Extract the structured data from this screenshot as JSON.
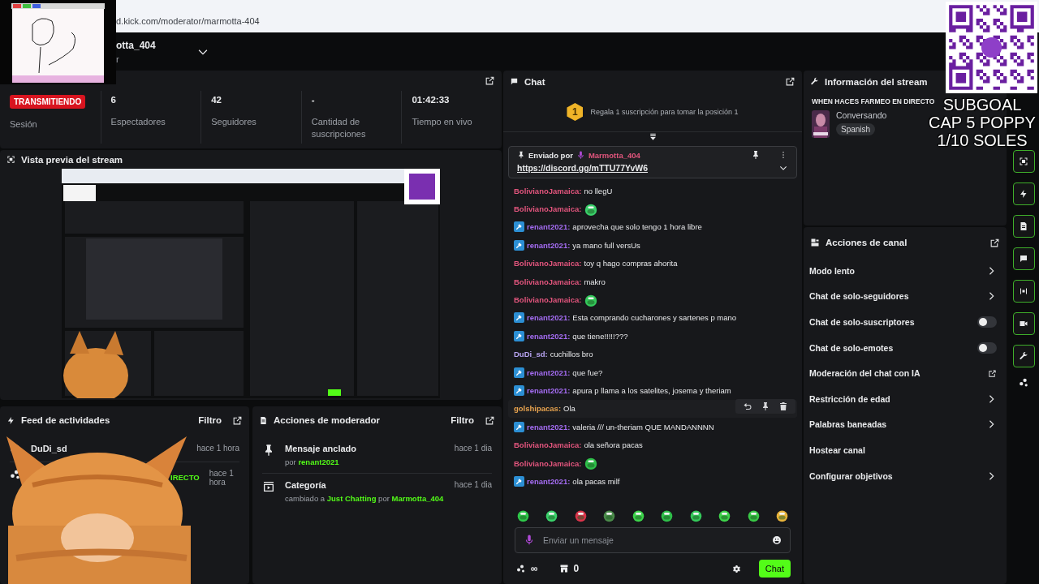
{
  "browser": {
    "url": "d.kick.com/moderator/marmotta-404"
  },
  "header": {
    "channel": "otta_404",
    "role": "r"
  },
  "stats": [
    {
      "kind": "badge",
      "value": "TRANSMITIENDO",
      "label": "Sesión"
    },
    {
      "kind": "number",
      "value": "6",
      "label": "Espectadores"
    },
    {
      "kind": "number",
      "value": "42",
      "label": "Seguidores"
    },
    {
      "kind": "number",
      "value": "-",
      "label": "Cantidad de suscripciones"
    },
    {
      "kind": "number",
      "value": "01:42:33",
      "label": "Tiempo en vivo"
    }
  ],
  "preview": {
    "title": "Vista previa del stream",
    "kind": "picture"
  },
  "activity_feed": {
    "title": "Feed de actividades",
    "filter": "Filtro",
    "items": [
      {
        "name": "DuDi_sd",
        "time": "hace 1 hora"
      },
      {
        "time": "hace 1 hora",
        "detail": "IRECTO"
      }
    ]
  },
  "mod_actions": {
    "title": "Acciones de moderador",
    "filter": "Filtro",
    "items": [
      {
        "kind": "pin",
        "title": "Mensaje anclado",
        "detail": [
          {
            "text": "por "
          },
          {
            "text": "renant2021",
            "highlight": true
          }
        ],
        "time": "hace 1 dia"
      },
      {
        "kind": "category",
        "title": "Categoría",
        "detail": [
          {
            "text": "cambiado a "
          },
          {
            "text": "Just Chatting",
            "highlight": true
          },
          {
            "text": " por "
          },
          {
            "text": "Marmotta_404",
            "highlight": true
          }
        ],
        "time": "hace 1 dia"
      }
    ]
  },
  "chat": {
    "title": "Chat",
    "goal": {
      "rank": "1",
      "text": "Regala 1 suscripción para tomar la posición 1"
    },
    "pinned": {
      "label": "Enviado por",
      "user": "Marmotta_404",
      "link": "https://discord.gg/mTTU77YvW6"
    },
    "messages": [
      {
        "user": "BolivianoJamaica:",
        "color": "#e2557d",
        "moderator": false,
        "kind": "text",
        "text": "no llegU",
        "highlighted": false
      },
      {
        "user": "BolivianoJamaica:",
        "color": "#e2557d",
        "moderator": false,
        "kind": "emote",
        "highlighted": false
      },
      {
        "user": "renant2021:",
        "color": "#a46cf2",
        "moderator": true,
        "kind": "text",
        "text": "aprovecha que solo tengo 1 hora libre",
        "highlighted": false
      },
      {
        "user": "renant2021:",
        "color": "#a46cf2",
        "moderator": true,
        "kind": "text",
        "text": "ya mano full versUs",
        "highlighted": false
      },
      {
        "user": "BolivianoJamaica:",
        "color": "#e2557d",
        "moderator": false,
        "kind": "text",
        "text": "toy q hago compras ahorita",
        "highlighted": false
      },
      {
        "user": "BolivianoJamaica:",
        "color": "#e2557d",
        "moderator": false,
        "kind": "text",
        "text": "makro",
        "highlighted": false
      },
      {
        "user": "BolivianoJamaica:",
        "color": "#e2557d",
        "moderator": false,
        "kind": "emote",
        "highlighted": false
      },
      {
        "user": "renant2021:",
        "color": "#a46cf2",
        "moderator": true,
        "kind": "text",
        "text": "Esta comprando cucharones y sartenes p mano",
        "highlighted": false
      },
      {
        "user": "renant2021:",
        "color": "#a46cf2",
        "moderator": true,
        "kind": "text",
        "text": "que tiene!!!!!???",
        "highlighted": false
      },
      {
        "user": "DuDi_sd:",
        "color": "#b8a4f2",
        "moderator": false,
        "kind": "text",
        "text": "cuchillos bro",
        "highlighted": false
      },
      {
        "user": "renant2021:",
        "color": "#a46cf2",
        "moderator": true,
        "kind": "text",
        "text": "que fue?",
        "highlighted": false
      },
      {
        "user": "renant2021:",
        "color": "#a46cf2",
        "moderator": true,
        "kind": "text",
        "text": "apura p llama a los satelites, josema y theriam",
        "highlighted": false
      },
      {
        "user": "golshipacas:",
        "color": "#e6a24e",
        "moderator": false,
        "kind": "text",
        "text": "Ola",
        "highlighted": true
      },
      {
        "user": "renant2021:",
        "color": "#a46cf2",
        "moderator": true,
        "kind": "text",
        "text": "valeria /// un-theriam QUE MANDANNNN",
        "highlighted": false
      },
      {
        "user": "BolivianoJamaica:",
        "color": "#e2557d",
        "moderator": false,
        "kind": "text",
        "text": "ola señora pacas",
        "highlighted": false
      },
      {
        "user": "BolivianoJamaica:",
        "color": "#e2557d",
        "moderator": false,
        "kind": "emote",
        "highlighted": false
      },
      {
        "user": "renant2021:",
        "color": "#a46cf2",
        "moderator": true,
        "kind": "text",
        "text": "ola pacas milf",
        "highlighted": false
      }
    ],
    "input": {
      "placeholder": "Enviar un mensaje"
    },
    "points": "∞",
    "store_count": "0",
    "send": "Chat"
  },
  "stream_info": {
    "title": "Información del stream",
    "stream_title": "WHEN HACES FARMEO EN DIRECTO",
    "category": "Conversando",
    "language": "Spanish"
  },
  "channel_actions": {
    "title": "Acciones de canal",
    "items": [
      {
        "label": "Modo lento",
        "kind": "arrow"
      },
      {
        "label": "Chat de solo-seguidores",
        "kind": "arrow"
      },
      {
        "label": "Chat de solo-suscriptores",
        "kind": "toggle",
        "on": false
      },
      {
        "label": "Chat de solo-emotes",
        "kind": "toggle",
        "on": false
      },
      {
        "label": "Moderación del chat con IA",
        "kind": "external"
      },
      {
        "label": "Restricción de edad",
        "kind": "arrow"
      },
      {
        "label": "Palabras baneadas",
        "kind": "arrow"
      },
      {
        "label": "Hostear canal",
        "kind": "plain"
      },
      {
        "label": "Configurar objetivos",
        "kind": "arrow"
      }
    ]
  },
  "overlay_text": [
    "SUBGOAL",
    "CAP 5 POPPY",
    "1/10 SOLES"
  ]
}
